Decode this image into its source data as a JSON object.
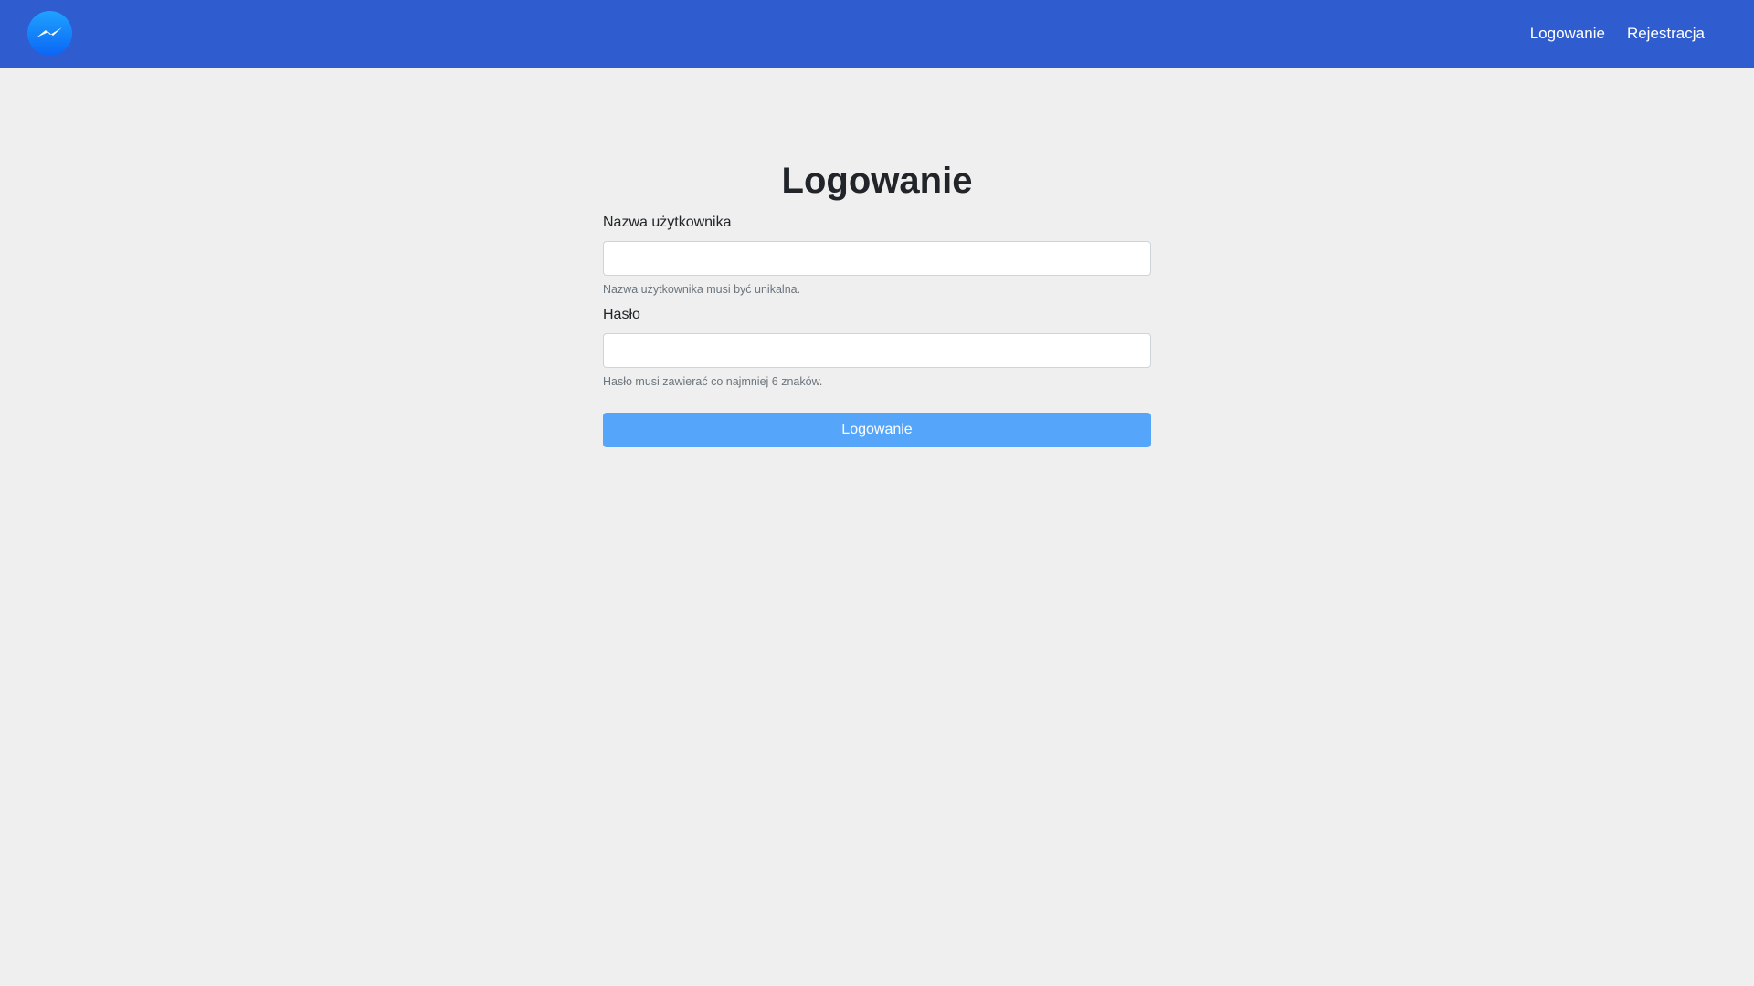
{
  "header": {
    "logo_icon": "messenger-icon",
    "nav": {
      "login_label": "Logowanie",
      "register_label": "Rejestracja"
    },
    "background_color": "#2f5ccf"
  },
  "form": {
    "title": "Logowanie",
    "username": {
      "label": "Nazwa użytkownika",
      "value": "",
      "placeholder": "",
      "help": "Nazwa użytkownika musi być unikalna."
    },
    "password": {
      "label": "Hasło",
      "value": "",
      "placeholder": "",
      "help": "Hasło musi zawierać co najmniej 6 znaków."
    },
    "submit_label": "Logowanie",
    "submit_color": "#55a6fb"
  }
}
